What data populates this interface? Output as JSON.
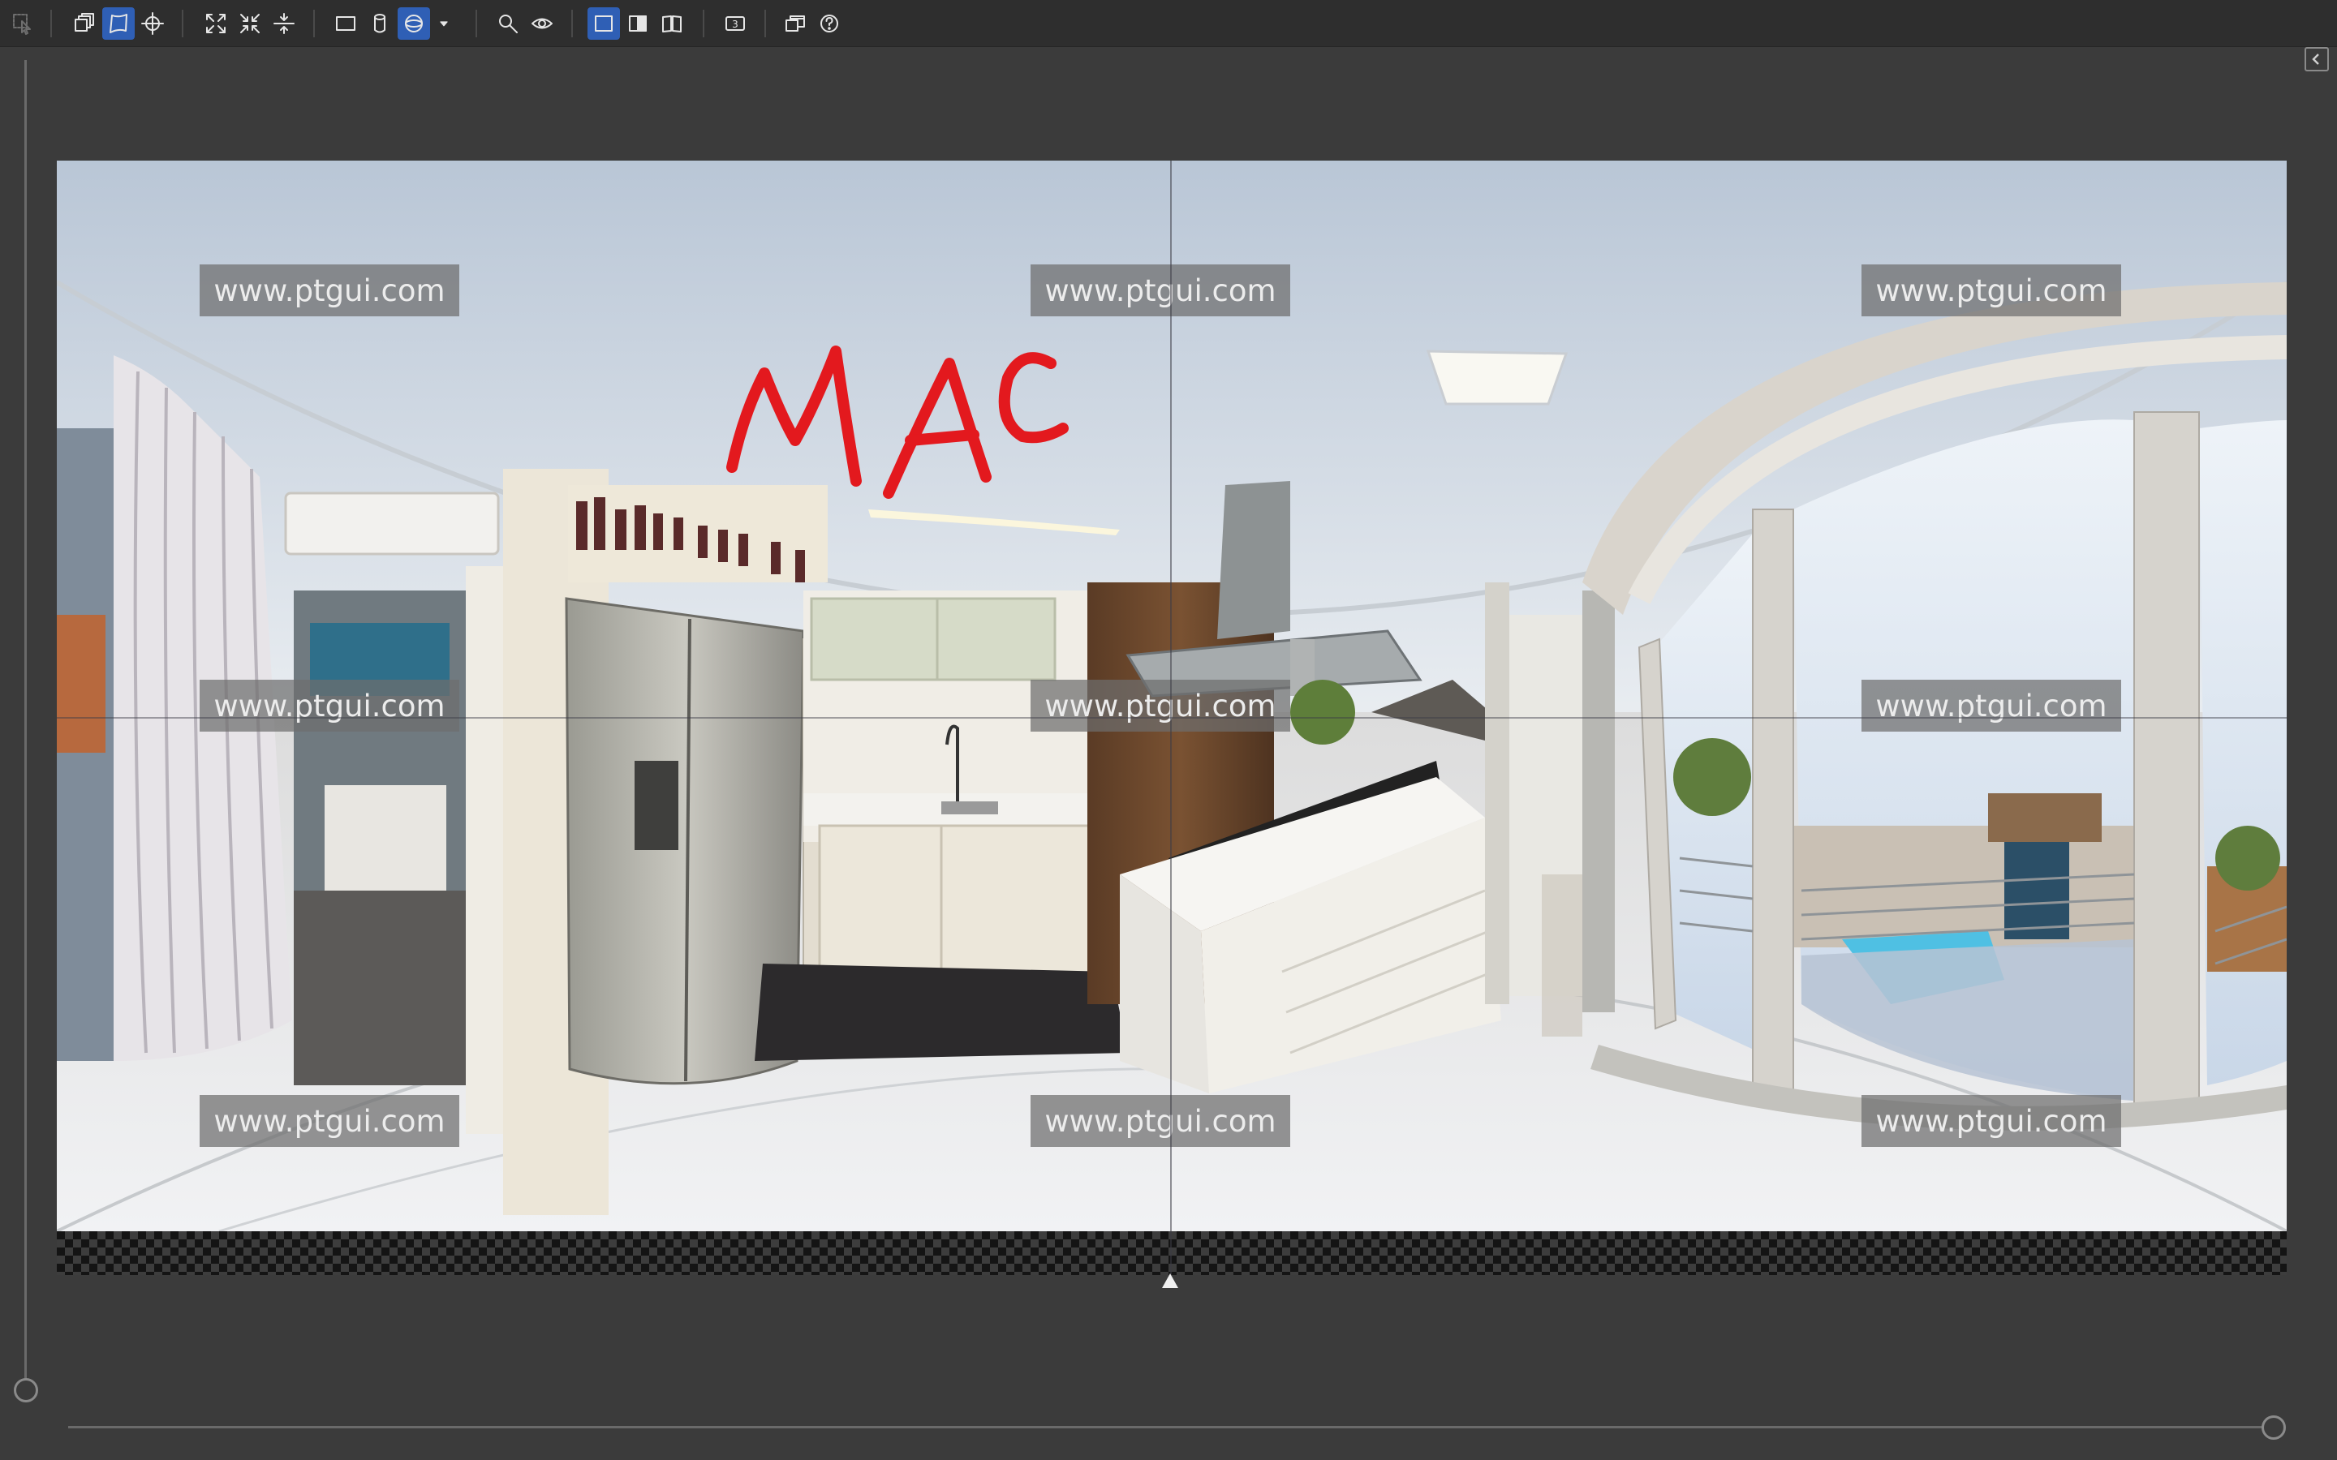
{
  "toolbar": {
    "tools": [
      {
        "name": "select-tool",
        "icon": "cursor-select-icon",
        "active": false,
        "disabled": true
      },
      {
        "name": "image-stack-tool",
        "icon": "image-stack-icon",
        "active": false
      },
      {
        "name": "perspective-tool",
        "icon": "perspective-warp-icon",
        "active": true
      },
      {
        "name": "center-point-tool",
        "icon": "crosshair-icon",
        "active": false
      },
      {
        "name": "fit-panorama-tool",
        "icon": "expand-arrows-icon",
        "active": false
      },
      {
        "name": "fit-content-tool",
        "icon": "collapse-arrows-icon",
        "active": false
      },
      {
        "name": "straighten-tool",
        "icon": "level-horizon-icon",
        "active": false
      },
      {
        "name": "rectilinear-projection",
        "icon": "rectangle-icon",
        "active": false
      },
      {
        "name": "cylindrical-projection",
        "icon": "cylinder-icon",
        "active": false
      },
      {
        "name": "spherical-projection",
        "icon": "sphere-icon",
        "active": true
      },
      {
        "name": "projection-dropdown",
        "icon": "dropdown-arrow-icon",
        "active": false
      },
      {
        "name": "zoom-tool",
        "icon": "magnifier-icon",
        "active": false
      },
      {
        "name": "preview-tool",
        "icon": "eye-icon",
        "active": false
      },
      {
        "name": "view-single",
        "icon": "single-view-icon",
        "active": true
      },
      {
        "name": "view-split",
        "icon": "split-view-icon",
        "active": false
      },
      {
        "name": "view-book",
        "icon": "book-view-icon",
        "active": false
      },
      {
        "name": "numbers-toggle",
        "icon": "numbered-box-icon",
        "active": false
      },
      {
        "name": "detach-window",
        "icon": "window-stack-icon",
        "active": false
      },
      {
        "name": "help",
        "icon": "help-circle-icon",
        "active": false
      }
    ],
    "numbers_glyph": "3"
  },
  "panorama": {
    "watermark_text": "www.ptgui.com",
    "annotation_text": "MAC",
    "annotation_color": "#e3191e"
  },
  "sliders": {
    "vertical_level": 0.0,
    "horizontal_level": 1.0
  },
  "panel_toggle_icon": "chevron-left-icon"
}
